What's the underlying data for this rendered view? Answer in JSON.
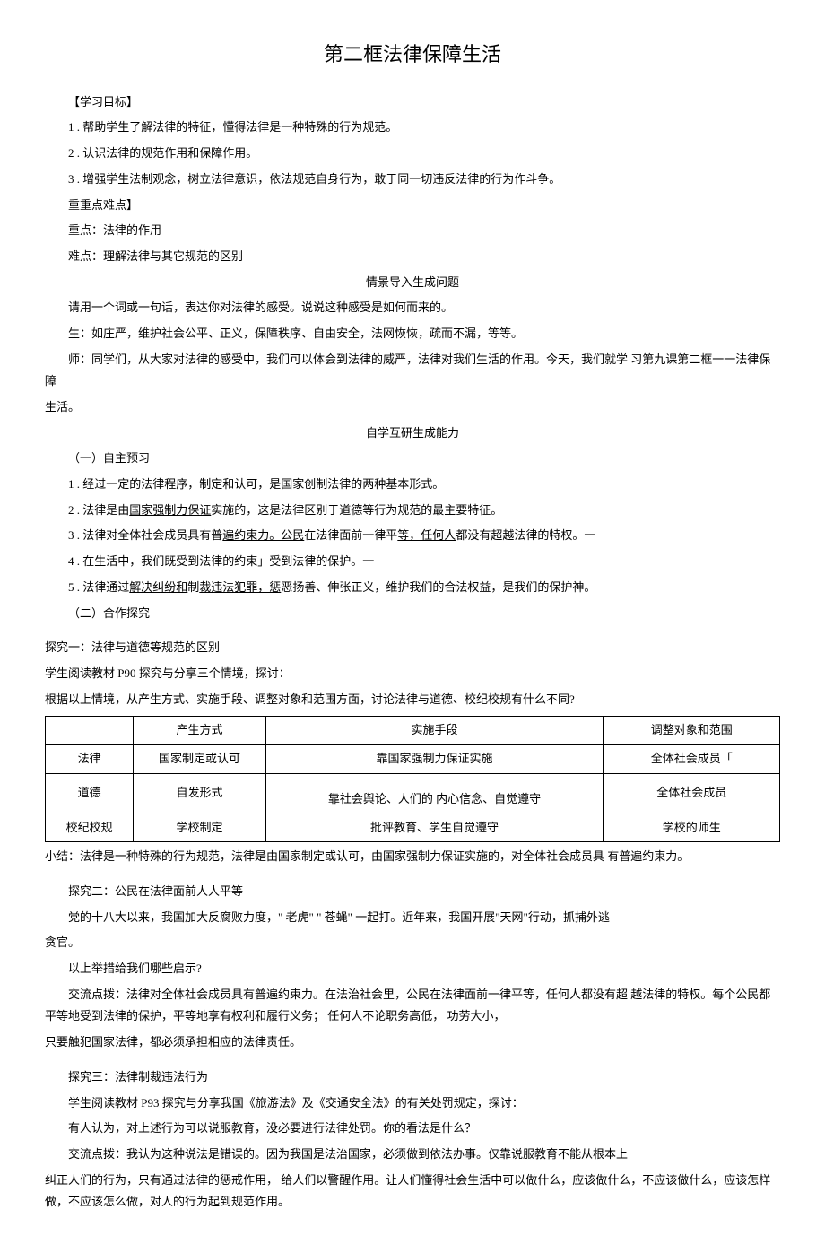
{
  "title": "第二框法律保障生活",
  "objectives_heading": "【学习目标】",
  "objectives": [
    "1 . 帮助学生了解法律的特征，懂得法律是一种特殊的行为规范。",
    "2 . 认识法律的规范作用和保障作用。",
    "3  . 增强学生法制观念，树立法律意识，依法规范自身行为，敢于同一切违反法律的行为作斗争。"
  ],
  "kd_heading": "重重点难点】",
  "kd_key": "重点：法律的作用",
  "kd_diff": "难点：理解法律与其它规范的区别",
  "scene_heading": "情景导入生成问题",
  "scene_p1": "请用一个词或一句话，表达你对法律的感受。说说这种感受是如何而来的。",
  "scene_p2": "生：如庄严，维护社会公平、正义，保障秩序、自由安全，法网恢恢，疏而不漏，等等。",
  "scene_p3a": "师：同学们，从大家对法律的感受中，我们可以体会到法律的威严，法律对我们生活的作用。今天，我们就学 习第九课第二框一一法律保障",
  "scene_p3b": "生活。",
  "self_heading": "自学互研生成能力",
  "self_h1": "（一）自主预习",
  "self_items": {
    "i1": "1 . 经过一定的法律程序，制定和认可，是国家创制法律的两种基本形式。",
    "i2a": "2 . 法律是由",
    "i2u": "国家强制力保证",
    "i2b": "实施的，这是法律区别于道德等行为规范的最主要特征。",
    "i3a": "3 . 法律对全体社会成员具有普",
    "i3u1": "遍约束力。公民",
    "i3b": "在法律面前一律平",
    "i3u2": "等，任何人",
    "i3c": "都没有超越法律的特权。一",
    "i4": "4 . 在生活中，我们既受到法律的约束」受到法律的保护。一",
    "i5a": "5 . 法律通过",
    "i5u1": "解决纠纷和",
    "i5b": "制",
    "i5u2": "裁违法犯罪，惩",
    "i5c": "恶扬善、伸张正义，维护我们的合法权益，是我们的保护神。"
  },
  "coop_heading": "（二）合作探究",
  "inq1_h": "探究一：法律与道德等规范的区别",
  "inq1_p1": "学生阅读教材 P90 探究与分享三个情境，探讨：",
  "inq1_p2": "根据以上情境，从产生方式、实施手段、调整对象和范围方面，讨论法律与道德、校纪校规有什么不同?",
  "table": {
    "h": [
      "",
      "产生方式",
      "实施手段",
      "调整对象和范围"
    ],
    "r1": [
      "法律",
      "国家制定或认可",
      "靠国家强制力保证实施",
      "全体社会成员「"
    ],
    "r2": [
      "道德",
      "自发形式",
      "靠社会舆论、人们的 内心信念、自觉遵守",
      "全体社会成员"
    ],
    "r3": [
      "校纪校规",
      "学校制定",
      "批评教育、学生自觉遵守",
      "学校的师生"
    ]
  },
  "inq1_sum": "小结：法律是一种特殊的行为规范，法律是由国家制定或认可，由国家强制力保证实施的，对全体社会成员具 有普遍约束力。",
  "inq2_h": "探究二：公民在法律面前人人平等",
  "inq2_p1a": "党的十八大以来，我国加大反腐败力度，\" 老虎\"  \" 苍蝇\"  一起打。近年来，我国开展\"天网\"行动，抓捕外逃",
  "inq2_p1b": "贪官。",
  "inq2_p2": "以上举措给我们哪些启示?",
  "inq2_p3a": "交流点拨：法律对全体社会成员具有普遍约束力。在法治社会里，公民在法律面前一律平等，任何人都没有超 越法律的特权。每个公民都平等地受到法律的保护，平等地享有权利和履行义务； 任何人不论职务高低， 功劳大小，",
  "inq2_p3b": "只要触犯国家法律，都必须承担相应的法律责任。",
  "inq3_h": "探究三：法律制裁违法行为",
  "inq3_p1": "学生阅读教材 P93 探究与分享我国《旅游法》及《交通安全法》的有关处罚规定，探讨：",
  "inq3_p2": "有人认为，对上述行为可以说服教育，没必要进行法律处罚。你的看法是什么？",
  "inq3_p3": "交流点拨：我认为这种说法是错误的。因为我国是法治国家，必须做到依法办事。仅靠说服教育不能从根本上",
  "inq3_p4": "纠正人们的行为，只有通过法律的惩戒作用， 给人们以警醒作用。让人们懂得社会生活中可以做什么，应该做什么，不应该做什么，应该怎样做，不应该怎么做，对人的行为起到规范作用。"
}
